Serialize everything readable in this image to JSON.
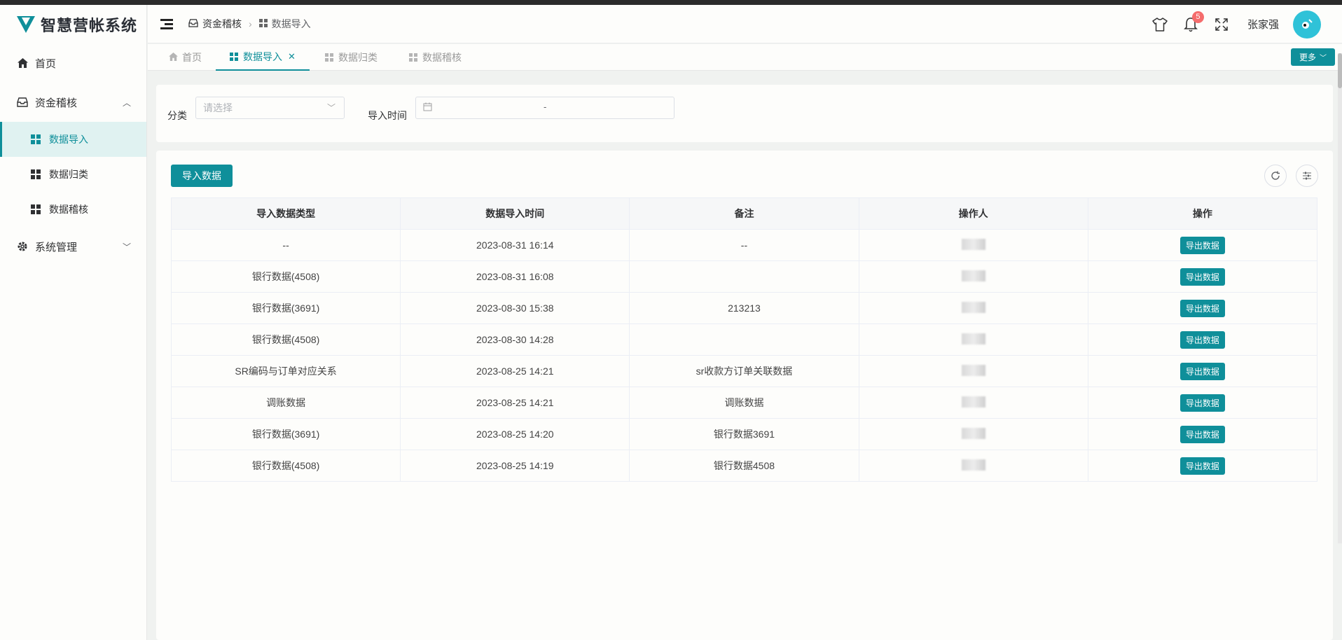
{
  "app": {
    "title": "智慧营帐系统",
    "brand_color": "#0f8f9a"
  },
  "sidebar": {
    "items": [
      {
        "label": "首页",
        "icon": "home-icon"
      },
      {
        "label": "资金稽核",
        "icon": "inbox-icon",
        "expanded": true,
        "children": [
          {
            "label": "数据导入",
            "active": true
          },
          {
            "label": "数据归类"
          },
          {
            "label": "数据稽核"
          }
        ]
      },
      {
        "label": "系统管理",
        "icon": "gear-icon",
        "expanded": false
      }
    ]
  },
  "header": {
    "breadcrumb": [
      "资金稽核",
      "数据导入"
    ],
    "notifications": "5",
    "username": "张家强"
  },
  "tabs": [
    {
      "label": "首页",
      "active": false
    },
    {
      "label": "数据导入",
      "active": true,
      "closable": true
    },
    {
      "label": "数据归类",
      "active": false
    },
    {
      "label": "数据稽核",
      "active": false
    }
  ],
  "more_label": "更多",
  "filter": {
    "category_label": "分类",
    "category_placeholder": "请选择",
    "time_label": "导入时间",
    "date_separator": "-"
  },
  "toolbar": {
    "import_label": "导入数据"
  },
  "table": {
    "columns": [
      "导入数据类型",
      "数据导入时间",
      "备注",
      "操作人",
      "操作"
    ],
    "action_label": "导出数据",
    "rows": [
      {
        "type": "--",
        "time": "2023-08-31 16:14",
        "note": "--",
        "operator": ""
      },
      {
        "type": "银行数据(4508)",
        "time": "2023-08-31 16:08",
        "note": "",
        "operator": ""
      },
      {
        "type": "银行数据(3691)",
        "time": "2023-08-30 15:38",
        "note": "213213",
        "operator": ""
      },
      {
        "type": "银行数据(4508)",
        "time": "2023-08-30 14:28",
        "note": "",
        "operator": ""
      },
      {
        "type": "SR编码与订单对应关系",
        "time": "2023-08-25 14:21",
        "note": "sr收款方订单关联数据",
        "operator": ""
      },
      {
        "type": "调账数据",
        "time": "2023-08-25 14:21",
        "note": "调账数据",
        "operator": ""
      },
      {
        "type": "银行数据(3691)",
        "time": "2023-08-25 14:20",
        "note": "银行数据3691",
        "operator": ""
      },
      {
        "type": "银行数据(4508)",
        "time": "2023-08-25 14:19",
        "note": "银行数据4508",
        "operator": ""
      }
    ]
  }
}
